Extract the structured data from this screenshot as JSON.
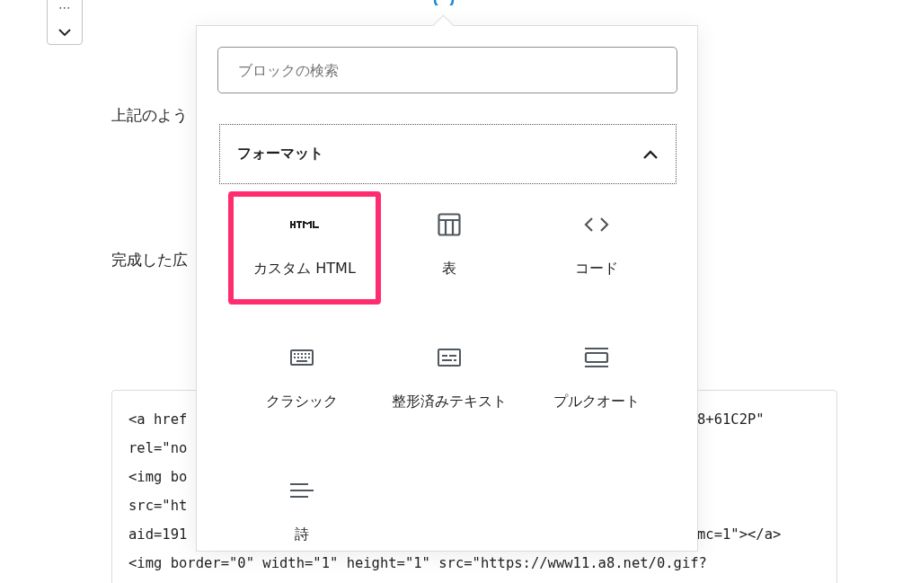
{
  "block_toolbar": {
    "more": "⋯"
  },
  "paragraphs": [
    "上記のよう",
    "完成した広"
  ],
  "code_block": {
    "lines": [
      {
        "left": "<a href",
        "right": "8+61C2P\""
      },
      {
        "left": "rel=\"no"
      },
      {
        "left": "<img bo"
      },
      {
        "left": "src=\"ht"
      },
      {
        "left": "aid=191",
        "right": "mc=1\"></a>"
      },
      {
        "left": "<img border=\"0\" width=\"1\" height=\"1\" src=\"https://www11.a8.net/0.gif?"
      }
    ]
  },
  "inserter": {
    "search": {
      "placeholder": "ブロックの検索"
    },
    "category": {
      "title": "フォーマット",
      "expanded": true
    },
    "blocks": [
      {
        "kind": "html",
        "label": "カスタム HTML",
        "selected": true
      },
      {
        "kind": "table",
        "label": "表",
        "selected": false
      },
      {
        "kind": "code",
        "label": "コード",
        "selected": false
      },
      {
        "kind": "classic",
        "label": "クラシック",
        "selected": false
      },
      {
        "kind": "preformatted",
        "label": "整形済みテキスト",
        "selected": false
      },
      {
        "kind": "pullquote",
        "label": "プルクオート",
        "selected": false
      },
      {
        "kind": "verse",
        "label": "詩",
        "selected": false
      }
    ]
  }
}
